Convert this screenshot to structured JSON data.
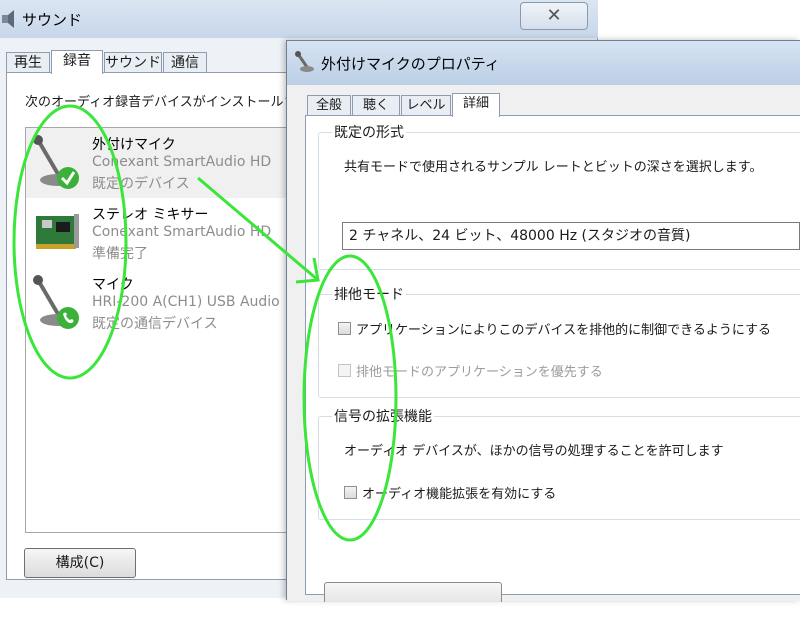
{
  "sound_window": {
    "title": "サウンド",
    "close_symbol": "✕",
    "tabs": [
      "再生",
      "録音",
      "サウンド",
      "通信"
    ],
    "active_tab": "録音",
    "description": "次のオーディオ録音デバイスがインストールされ",
    "devices": [
      {
        "name": "外付けマイク",
        "driver": "Conexant SmartAudio HD",
        "status": "既定のデバイス",
        "icon": "microphone-default-icon",
        "selected": true
      },
      {
        "name": "ステレオ ミキサー",
        "driver": "Conexant SmartAudio HD",
        "status": "準備完了",
        "icon": "sound-card-icon",
        "selected": false
      },
      {
        "name": "マイク",
        "driver": "HRI-200 A(CH1) USB Audio",
        "status": "既定の通信デバイス",
        "icon": "microphone-communication-icon",
        "selected": false
      }
    ],
    "configure_button": "構成(C)"
  },
  "properties_window": {
    "title": "外付けマイクのプロパティ",
    "tabs": [
      "全般",
      "聴く",
      "レベル",
      "詳細"
    ],
    "active_tab": "詳細",
    "default_format": {
      "group_title": "既定の形式",
      "description": "共有モードで使用されるサンプル レートとビットの深さを選択します。",
      "selected_value": "2 チャネル、24 ビット、48000 Hz (スタジオの音質)"
    },
    "exclusive_mode": {
      "group_title": "排他モード",
      "allow_exclusive_label": "アプリケーションによりこのデバイスを排他的に制御できるようにする",
      "allow_exclusive_checked": false,
      "priority_label": "排他モードのアプリケーションを優先する",
      "priority_checked": false,
      "priority_enabled": false
    },
    "signal_enhancements": {
      "group_title": "信号の拡張機能",
      "description": "オーディオ デバイスが、ほかの信号の処理することを許可します",
      "enable_label": "オーディオ機能拡張を有効にする",
      "enable_checked": false
    }
  },
  "colors": {
    "annotation": "#39e639",
    "disabled_text": "#9c9c9c",
    "secondary_text": "#8d8d8d"
  }
}
